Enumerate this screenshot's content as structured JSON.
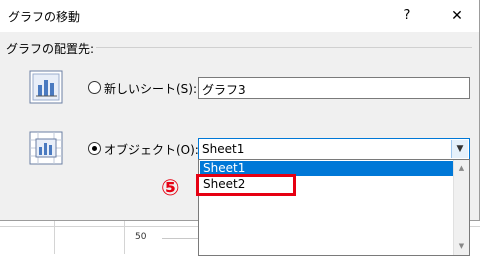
{
  "dialog": {
    "title": "グラフの移動",
    "help": "?",
    "close": "✕"
  },
  "group": {
    "label": "グラフの配置先:"
  },
  "options": {
    "new_sheet": {
      "label": "新しいシート(S):",
      "value": "グラフ3",
      "selected": false
    },
    "object": {
      "label": "オブジェクト(O):",
      "value": "Sheet1",
      "selected": true
    }
  },
  "dropdown": {
    "items": [
      "Sheet1",
      "Sheet2"
    ],
    "highlighted_index": 0,
    "scroll_up": "▲",
    "scroll_down": "▼",
    "combo_arrow": "▼"
  },
  "annotation": {
    "step": "⑤",
    "highlight_color": "#e60012"
  },
  "background": {
    "axis_tick_label": "50"
  },
  "colors": {
    "accent": "#0078d7",
    "dialog_bg": "#f0f0f0"
  }
}
